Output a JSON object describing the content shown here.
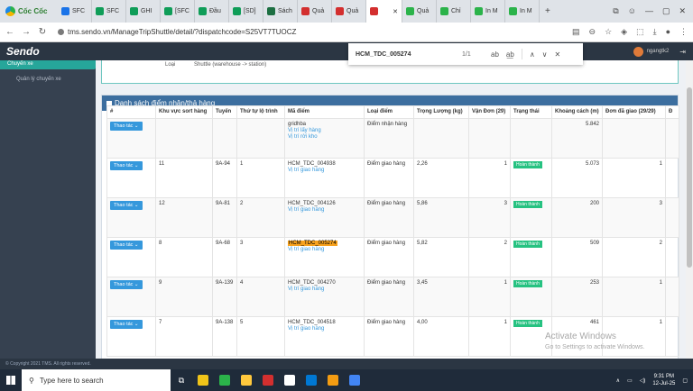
{
  "browser": {
    "name": "Cốc Cốc",
    "tabs": [
      {
        "label": "SFC",
        "color": "#1a73e8"
      },
      {
        "label": "SFC",
        "color": "#0f9d58"
      },
      {
        "label": "GHI",
        "color": "#0f9d58"
      },
      {
        "label": "[SFC",
        "color": "#0f9d58"
      },
      {
        "label": "Đầu",
        "color": "#0f9d58"
      },
      {
        "label": "[SD]",
        "color": "#0f9d58"
      },
      {
        "label": "Sách",
        "color": "#1d6f42"
      },
      {
        "label": "Quả",
        "color": "#d32f2f"
      },
      {
        "label": "Quả",
        "color": "#d32f2f"
      },
      {
        "label": "",
        "color": "#d32f2f",
        "active": true
      },
      {
        "label": "Quả",
        "color": "#2bb34a"
      },
      {
        "label": "Chỉ",
        "color": "#2bb34a"
      },
      {
        "label": "In M",
        "color": "#2bb34a"
      },
      {
        "label": "In M",
        "color": "#2bb34a"
      }
    ],
    "url": "tms.sendo.vn/ManageTripShuttle/detail/?dispatchcode=S25VT7TUOCZ"
  },
  "find_bar": {
    "query": "HCM_TDC_005274",
    "count": "1/1"
  },
  "app": {
    "logo": "Sendo",
    "user": "ngangtk2",
    "sidebar_active": "Chuyến xe",
    "sidebar_item": "Quản lý chuyến xe",
    "info_label": "Loại",
    "info_value": "Shuttle (warehouse -> station)",
    "panel_title": "Danh sách điểm nhận/thả hàng",
    "columns": [
      "#",
      "Khu vực sort hàng",
      "Tuyến",
      "Thứ tự lộ trình",
      "Mã điểm",
      "Loại điểm",
      "Trọng Lượng (kg)",
      "Vận Đơn (29)",
      "Trạng thái",
      "Khoảng cách (m)",
      "Đơn đã giao (29/29)",
      "Đ"
    ],
    "action_label": "Thao tác",
    "rows": [
      {
        "zone": "",
        "route": "",
        "order": "",
        "code": "gridhba",
        "links": [
          "Vị trí lấy hàng",
          "Vị trí rời kho"
        ],
        "type": "Điểm nhận hàng",
        "weight": "",
        "waybills": "",
        "status": "",
        "distance": "5.842",
        "delivered": ""
      },
      {
        "zone": "11",
        "route": "9A-94",
        "order": "1",
        "code": "HCM_TDC_004938",
        "links": [
          "Vị trí giao hàng"
        ],
        "type": "Điểm giao hàng",
        "weight": "2,26",
        "waybills": "1",
        "status": "Hoàn thành",
        "distance": "5.073",
        "delivered": "1"
      },
      {
        "zone": "12",
        "route": "9A-81",
        "order": "2",
        "code": "HCM_TDC_004126",
        "links": [
          "Vị trí giao hàng"
        ],
        "type": "Điểm giao hàng",
        "weight": "5,86",
        "waybills": "3",
        "status": "Hoàn thành",
        "distance": "200",
        "delivered": "3"
      },
      {
        "zone": "8",
        "route": "9A-68",
        "order": "3",
        "code": "HCM_TDC_005274",
        "links": [
          "Vị trí giao hàng"
        ],
        "type": "Điểm giao hàng",
        "weight": "5,82",
        "waybills": "2",
        "status": "Hoàn thành",
        "distance": "509",
        "delivered": "2",
        "highlight": true
      },
      {
        "zone": "9",
        "route": "9A-139",
        "order": "4",
        "code": "HCM_TDC_004270",
        "links": [
          "Vị trí giao hàng"
        ],
        "type": "Điểm giao hàng",
        "weight": "3,45",
        "waybills": "1",
        "status": "Hoàn thành",
        "distance": "253",
        "delivered": "1"
      },
      {
        "zone": "7",
        "route": "9A-138",
        "order": "5",
        "code": "HCM_TDC_004518",
        "links": [
          "Vị trí giao hàng"
        ],
        "type": "Điểm giao hàng",
        "weight": "4,00",
        "waybills": "1",
        "status": "Hoàn thành",
        "distance": "461",
        "delivered": "1"
      }
    ],
    "footer": "© Copyright 2021 TMS. All rights reserved."
  },
  "watermark": {
    "title": "Activate Windows",
    "subtitle": "Go to Settings to activate Windows."
  },
  "taskbar": {
    "search_placeholder": "Type here to search",
    "time": "9:31 PM",
    "date": "12-Jul-25",
    "app_colors": [
      "#f0c419",
      "#2bb34a",
      "#ffc83d",
      "#d32f2f",
      "#ffffff",
      "#0078d4",
      "#f39c12",
      "#4285f4"
    ]
  }
}
